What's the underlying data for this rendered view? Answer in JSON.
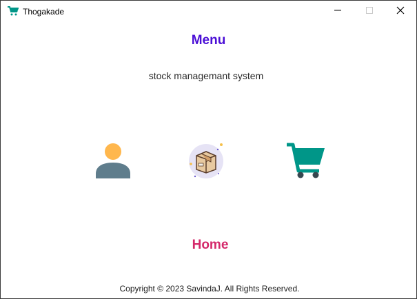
{
  "window": {
    "title": "Thogakade",
    "app_icon": "shopping-cart-icon",
    "controls": [
      "minimize-icon",
      "maximize-icon",
      "close-icon"
    ]
  },
  "main": {
    "heading": "Menu",
    "subtitle": "stock managemant system",
    "tiles": [
      {
        "icon": "customer-person-icon",
        "color": "#5f7d8c"
      },
      {
        "icon": "item-box-icon",
        "color": "#e8c9a0"
      },
      {
        "icon": "order-cart-icon",
        "color": "#009688"
      }
    ],
    "home_label": "Home"
  },
  "footer": {
    "copyright": "Copyright © 2023 SavindaJ. All Rights Reserved."
  },
  "colors": {
    "menu_heading": "#4b0fd6",
    "home_label": "#d4286a",
    "cart_teal": "#009688",
    "person_head": "#ffb74d",
    "person_body": "#5f7d8c"
  }
}
